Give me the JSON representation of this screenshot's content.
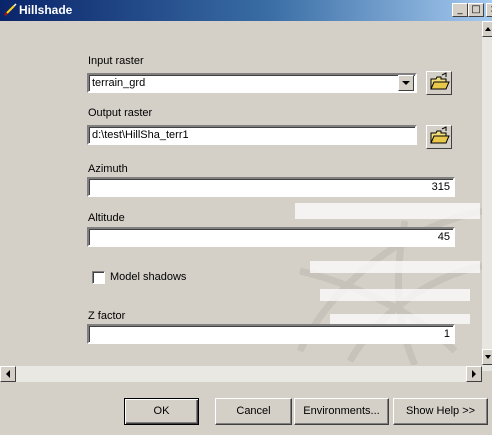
{
  "window": {
    "title": "Hillshade",
    "minimize_glyph": "_",
    "maximize_glyph": "□",
    "close_glyph": "×"
  },
  "form": {
    "input_raster": {
      "label": "Input raster",
      "value": "terrain_grd"
    },
    "output_raster": {
      "label": "Output raster",
      "value": "d:\\test\\HillSha_terr1"
    },
    "azimuth": {
      "label": "Azimuth",
      "value": "315"
    },
    "altitude": {
      "label": "Altitude",
      "value": "45"
    },
    "model_shadows": {
      "label": "Model shadows",
      "checked": false
    },
    "z_factor": {
      "label": "Z factor",
      "value": "1"
    }
  },
  "buttons": {
    "ok": "OK",
    "cancel": "Cancel",
    "environments": "Environments...",
    "show_help": "Show Help >>"
  },
  "icons": {
    "title": "hillshade-tool-icon",
    "open_folder": "open-folder-icon",
    "dropdown": "chevron-down-icon"
  },
  "colors": {
    "titlebar_start": "#0a246a",
    "titlebar_end": "#a6caf0",
    "face": "#d4d0c8"
  }
}
